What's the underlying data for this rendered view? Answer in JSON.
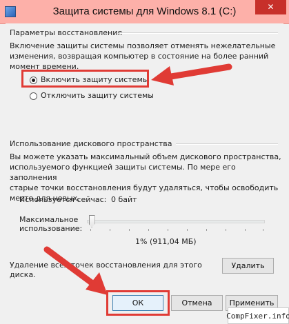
{
  "window": {
    "title": "Защита системы для Windows 8.1 (C:)",
    "close_glyph": "✕"
  },
  "restore_settings": {
    "header": "Параметры восстановления",
    "description_lines": [
      "Включение защиты системы позволяет отменять нежелательные",
      "изменения, возвращая компьютер в состояние на более ранний",
      "момент времени."
    ],
    "options": [
      {
        "label": "Включить защиту системы",
        "selected": true
      },
      {
        "label": "Отключить защиту системы",
        "selected": false
      }
    ]
  },
  "disk_usage": {
    "header": "Использование дискового пространства",
    "description_lines": [
      "Вы можете указать максимальный объем дискового пространства,",
      "используемого функцией защиты системы. По мере его заполнения",
      "старые точки восстановления будут удаляться, чтобы освободить",
      "место для новых."
    ],
    "current_usage_label": "Используется сейчас:",
    "current_usage_value": "0 байт",
    "max_usage_label_line1": "Максимальное",
    "max_usage_label_line2": "использование:",
    "slider_percent": 1,
    "max_usage_value": "1% (911,04 МБ)",
    "delete_text_line1": "Удаление всех точек восстановления для этого",
    "delete_text_line2": "диска.",
    "delete_button": "Удалить"
  },
  "buttons": {
    "ok": "ОК",
    "cancel": "Отмена",
    "apply": "Применить"
  },
  "watermark": "CompFixer.info",
  "colors": {
    "title_bar": "#fdb0a9",
    "close_button": "#c7302a",
    "highlight": "#e03b35"
  }
}
